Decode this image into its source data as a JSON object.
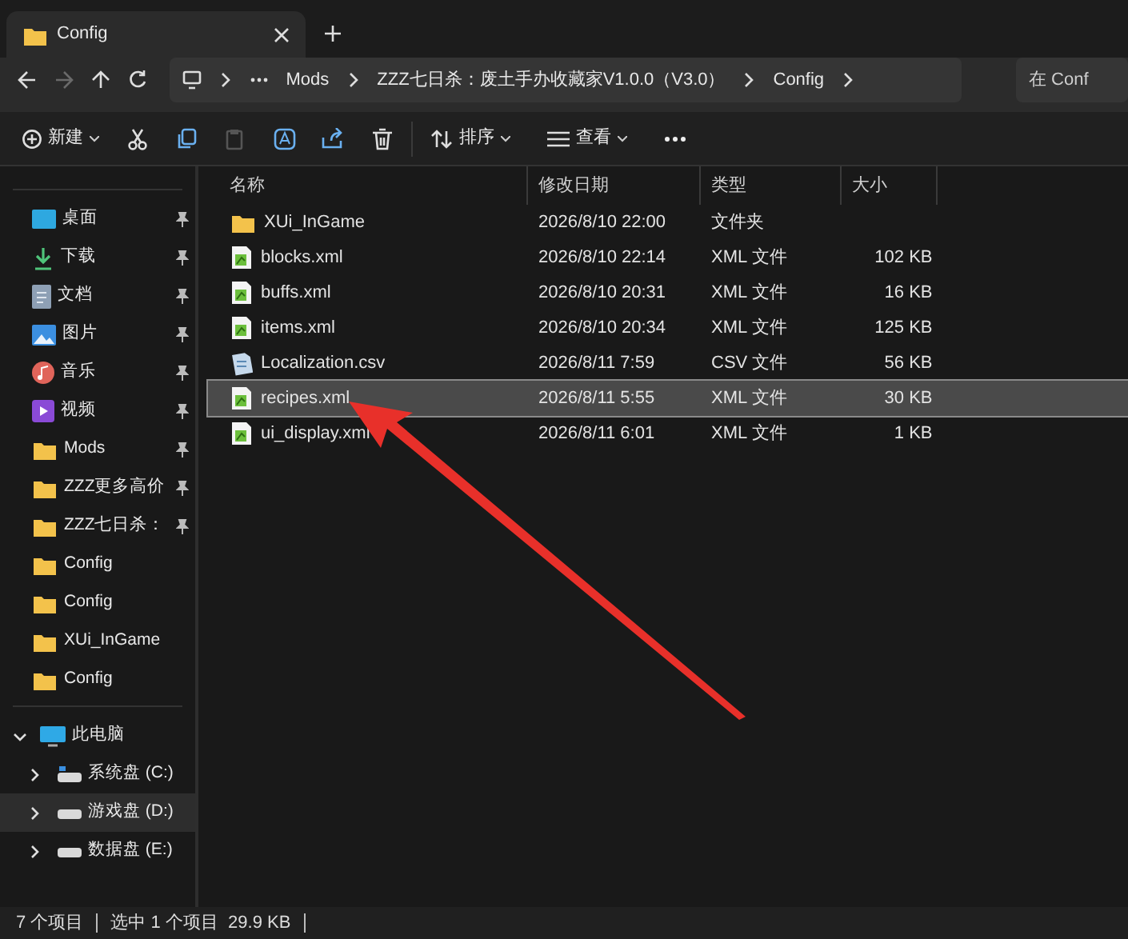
{
  "window": {
    "tab_title": "Config"
  },
  "nav": {
    "forward_disabled": true,
    "breadcrumbs": [
      "Mods",
      "ZZZ七日杀：废土手办收藏家V1.0.0（V3.0）",
      "Config"
    ],
    "search_placeholder": "在 Conf"
  },
  "toolbar": {
    "new_label": "新建",
    "paste_disabled": true,
    "sort_label": "排序",
    "view_label": "查看"
  },
  "sidebar": {
    "quick_access": [
      {
        "label": "桌面",
        "kind": "desktop",
        "pinned": true
      },
      {
        "label": "下载",
        "kind": "download",
        "pinned": true
      },
      {
        "label": "文档",
        "kind": "documents",
        "pinned": true
      },
      {
        "label": "图片",
        "kind": "pictures",
        "pinned": true
      },
      {
        "label": "音乐",
        "kind": "music",
        "pinned": true
      },
      {
        "label": "视频",
        "kind": "videos",
        "pinned": true
      },
      {
        "label": "Mods",
        "kind": "folder",
        "pinned": true
      },
      {
        "label": "ZZZ更多高价",
        "kind": "folder",
        "pinned": true
      },
      {
        "label": "ZZZ七日杀：",
        "kind": "folder",
        "pinned": true
      },
      {
        "label": "Config",
        "kind": "folder",
        "pinned": false
      },
      {
        "label": "Config",
        "kind": "folder",
        "pinned": false
      },
      {
        "label": "XUi_InGame",
        "kind": "folder",
        "pinned": false
      },
      {
        "label": "Config",
        "kind": "folder",
        "pinned": false
      }
    ],
    "this_pc": {
      "label": "此电脑",
      "expanded": true,
      "drives": [
        {
          "label": "系统盘 (C:)",
          "kind": "system",
          "selected": false
        },
        {
          "label": "游戏盘 (D:)",
          "kind": "drive",
          "selected": true
        },
        {
          "label": "数据盘 (E:)",
          "kind": "drive",
          "selected": false
        }
      ]
    }
  },
  "table": {
    "columns": [
      "名称",
      "修改日期",
      "类型",
      "大小"
    ],
    "rows": [
      {
        "name": "XUi_InGame",
        "kind": "folder",
        "modified": "2026/8/10 22:00",
        "type": "文件夹",
        "size": "",
        "selected": false
      },
      {
        "name": "blocks.xml",
        "kind": "xml",
        "modified": "2026/8/10 22:14",
        "type": "XML 文件",
        "size": "102 KB",
        "selected": false
      },
      {
        "name": "buffs.xml",
        "kind": "xml",
        "modified": "2026/8/10 20:31",
        "type": "XML 文件",
        "size": "16 KB",
        "selected": false
      },
      {
        "name": "items.xml",
        "kind": "xml",
        "modified": "2026/8/10 20:34",
        "type": "XML 文件",
        "size": "125 KB",
        "selected": false
      },
      {
        "name": "Localization.csv",
        "kind": "csv",
        "modified": "2026/8/11 7:59",
        "type": "CSV 文件",
        "size": "56 KB",
        "selected": false
      },
      {
        "name": "recipes.xml",
        "kind": "xml",
        "modified": "2026/8/11 5:55",
        "type": "XML 文件",
        "size": "30 KB",
        "selected": true
      },
      {
        "name": "ui_display.xml",
        "kind": "xml",
        "modified": "2026/8/11 6:01",
        "type": "XML 文件",
        "size": "1 KB",
        "selected": false
      }
    ]
  },
  "status_bar": {
    "item_count": "7 个项目",
    "selection": "选中 1 个项目  29.9 KB"
  }
}
